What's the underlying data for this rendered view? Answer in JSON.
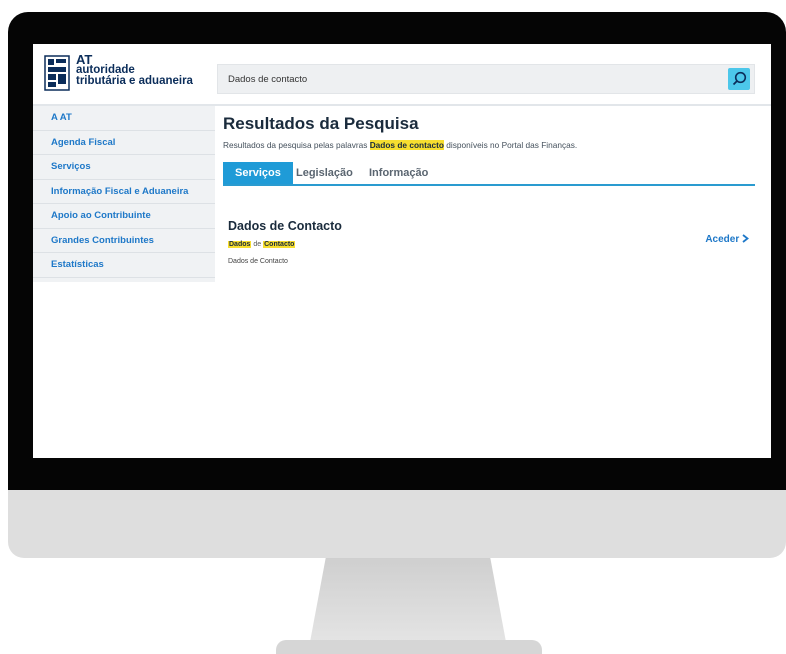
{
  "brand": {
    "short": "AT",
    "line1": "autoridade",
    "line2": "tributária e aduaneira"
  },
  "search": {
    "value": "Dados de contacto",
    "icon": "search-icon"
  },
  "sidebar": {
    "items": [
      {
        "label": "A AT"
      },
      {
        "label": "Agenda Fiscal"
      },
      {
        "label": "Serviços"
      },
      {
        "label": "Informação Fiscal e Aduaneira"
      },
      {
        "label": "Apoio ao Contribuinte"
      },
      {
        "label": "Grandes Contribuintes"
      },
      {
        "label": "Estatísticas"
      }
    ]
  },
  "main": {
    "title": "Resultados da Pesquisa",
    "subtitle_prefix": "Resultados da pesquisa pelas palavras",
    "subtitle_highlight": "Dados de contacto",
    "subtitle_suffix": "disponíveis no Portal das Finanças.",
    "tabs": [
      {
        "label": "Serviços",
        "active": true
      },
      {
        "label": "Legislação",
        "active": false
      },
      {
        "label": "Informação",
        "active": false
      }
    ],
    "result": {
      "title": "Dados de Contacto",
      "tag1": "Dados",
      "tag_mid": "de",
      "tag2": "Contacto",
      "description": "Dados de Contacto",
      "action": "Aceder"
    }
  },
  "colors": {
    "accent": "#1f9bd7",
    "link": "#1e78c8",
    "highlight": "#f7de2f",
    "search_button": "#4cc7ea"
  }
}
